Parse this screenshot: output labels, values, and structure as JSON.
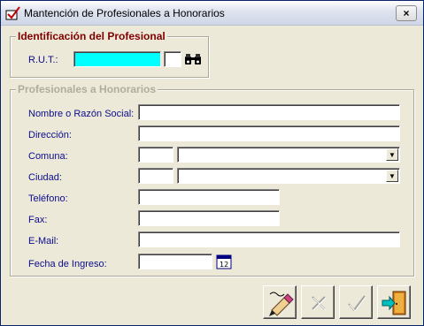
{
  "window": {
    "title": "Mantención de Profesionales a Honorarios",
    "close_label": "×"
  },
  "identification_group": {
    "legend": "Identificación del Profesional",
    "legend_color": "#800000",
    "rut_label": "R.U.T.:",
    "rut_value": "",
    "dv_value": "",
    "search_icon": "binoculars-icon"
  },
  "honorarios_group": {
    "legend": "Profesionales a Honorarios",
    "legend_color": "#b0ad9e",
    "fields": {
      "nombre": {
        "label": "Nombre o Razón Social:",
        "value": ""
      },
      "direccion": {
        "label": "Dirección:",
        "value": ""
      },
      "comuna": {
        "label": "Comuna:",
        "code": "",
        "value": ""
      },
      "ciudad": {
        "label": "Ciudad:",
        "code": "",
        "value": ""
      },
      "telefono": {
        "label": "Teléfono:",
        "value": ""
      },
      "fax": {
        "label": "Fax:",
        "value": ""
      },
      "email": {
        "label": "E-Mail:",
        "value": ""
      },
      "fecha_ingreso": {
        "label": "Fecha de Ingreso:",
        "value": "",
        "calendar_icon": "calendar-icon"
      }
    }
  },
  "toolbar": {
    "edit_icon": "pencil-edit-icon",
    "cancel_icon": "x-cancel-icon",
    "accept_icon": "check-accept-icon",
    "exit_icon": "exit-door-icon"
  },
  "colors": {
    "label_text": "#0c0c8c",
    "rut_field_bg": "#00ffff",
    "window_bg": "#ece9d8"
  }
}
